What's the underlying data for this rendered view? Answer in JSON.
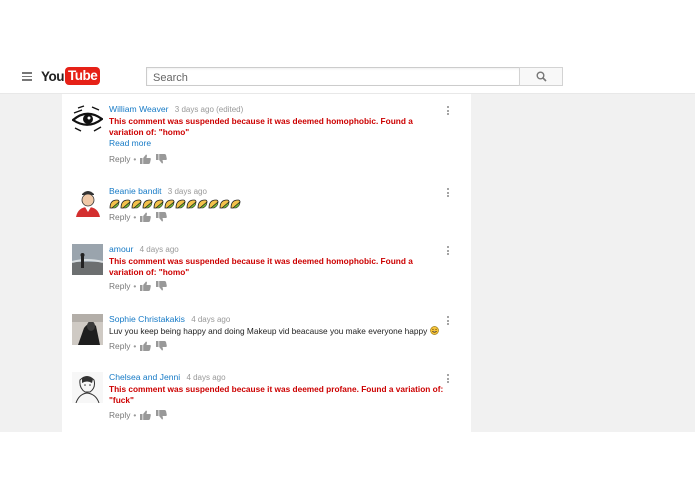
{
  "header": {
    "logo_you": "You",
    "logo_tube": "Tube",
    "search_placeholder": "Search"
  },
  "comments": [
    {
      "author": "William Weaver",
      "time": "3 days ago (edited)",
      "text": "This comment was suspended because it was deemed homophobic. Found a variation of: \"homo\"",
      "suspended": true,
      "read_more": "Read more",
      "reply": "Reply",
      "separator": "•"
    },
    {
      "author": "Beanie bandit",
      "time": "3 days ago",
      "text": "",
      "suspended": false,
      "emoji_row": "taco-emoji",
      "reply": "Reply",
      "separator": "•"
    },
    {
      "author": "amour",
      "time": "4 days ago",
      "text": "This comment was suspended because it was deemed homophobic. Found a variation of: \"homo\"",
      "suspended": true,
      "reply": "Reply",
      "separator": "•"
    },
    {
      "author": "Sophie Christakakis",
      "time": "4 days ago",
      "text": "Luv you keep being happy and doing Makeup vid beacause you make everyone happy",
      "suspended": false,
      "reply": "Reply",
      "separator": "•"
    },
    {
      "author": "Chelsea and Jenni",
      "time": "4 days ago",
      "text": "This comment was suspended because it was deemed profane. Found a variation of: \"fuck\"",
      "suspended": true,
      "reply": "Reply",
      "separator": "•"
    }
  ],
  "colors": {
    "link_blue": "#167ac6",
    "suspended_red": "#cc0000",
    "brand_red": "#e62117"
  }
}
